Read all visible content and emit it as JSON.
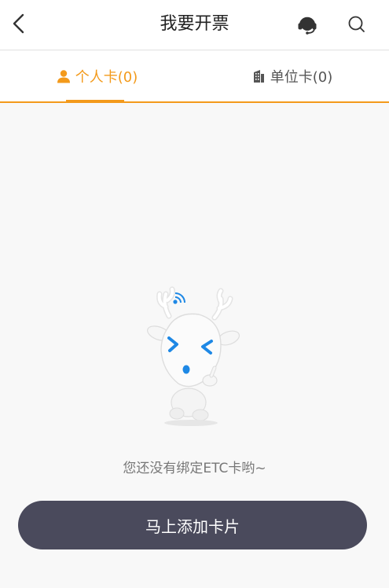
{
  "header": {
    "title": "我要开票",
    "back_icon": "chevron-left-icon",
    "service_icon": "headset-icon",
    "search_icon": "search-icon"
  },
  "tabs": [
    {
      "label": "个人卡(0)",
      "icon": "person-icon",
      "active": true
    },
    {
      "label": "单位卡(0)",
      "icon": "building-icon",
      "active": false
    }
  ],
  "empty_state": {
    "message": "您还没有绑定ETC卡哟~",
    "illustration": "deer-mascot"
  },
  "add_button": {
    "label": "马上添加卡片"
  },
  "colors": {
    "accent": "#f39a1b",
    "button_bg": "#4a4a5c",
    "background": "#f8f8f8",
    "mascot_blue": "#1e88e5"
  }
}
